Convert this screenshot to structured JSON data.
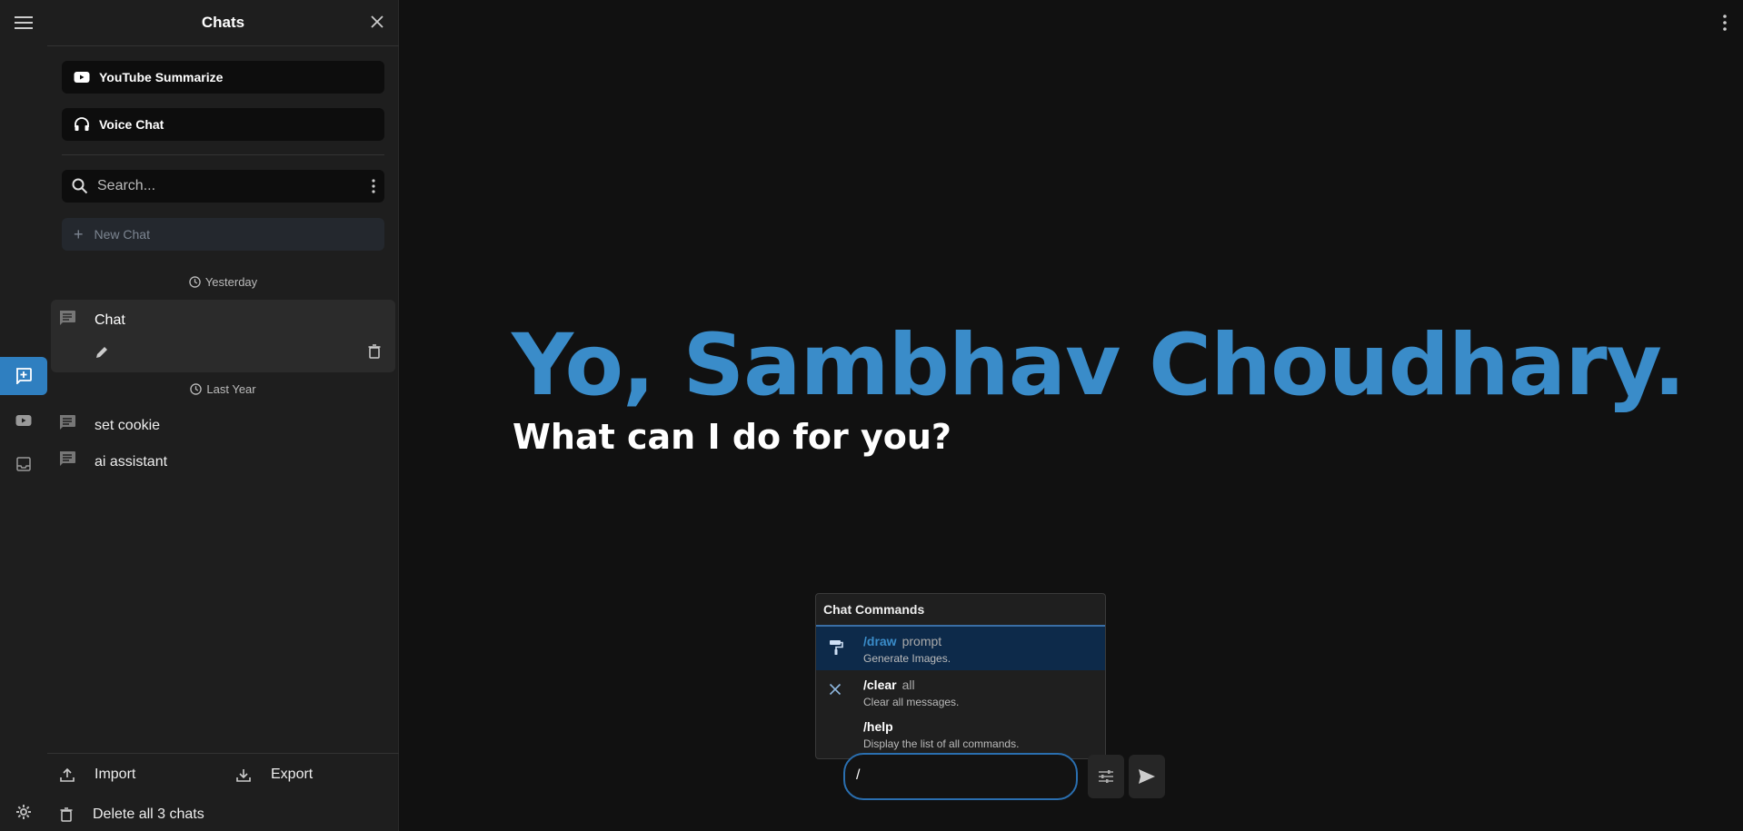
{
  "rail": {
    "icons": [
      "menu-icon",
      "new-chat-icon",
      "youtube-icon",
      "inbox-icon",
      "settings-icon"
    ]
  },
  "sidebar": {
    "title": "Chats",
    "actions": [
      {
        "label": "YouTube Summarize",
        "icon": "youtube-icon"
      },
      {
        "label": "Voice Chat",
        "icon": "headphones-icon"
      }
    ],
    "search_placeholder": "Search...",
    "new_chat_label": "New Chat",
    "groups": [
      {
        "label": "Yesterday",
        "chats": [
          "Chat"
        ]
      },
      {
        "label": "Last Year",
        "chats": [
          "set cookie",
          "ai assistant"
        ]
      }
    ],
    "footer": {
      "import_label": "Import",
      "export_label": "Export",
      "delete_label": "Delete all 3 chats"
    }
  },
  "main": {
    "greeting": "Yo, Sambhav Choudhary.",
    "subtitle": "What can I do for you?",
    "colors": {
      "greeting": "#3a8cc9",
      "accent": "#2f7fc0"
    }
  },
  "commands": {
    "title": "Chat Commands",
    "items": [
      {
        "prefix": "/",
        "name": "draw",
        "arg": "prompt",
        "desc": "Generate Images.",
        "icon": "paint-roller-icon",
        "selected": true
      },
      {
        "prefix": "/",
        "name": "clear",
        "arg": "all",
        "desc": "Clear all messages.",
        "icon": "close-icon",
        "selected": false
      },
      {
        "prefix": "/",
        "name": "help",
        "arg": "",
        "desc": "Display the list of all commands.",
        "icon": "",
        "selected": false
      }
    ]
  },
  "composer": {
    "value": "/"
  }
}
